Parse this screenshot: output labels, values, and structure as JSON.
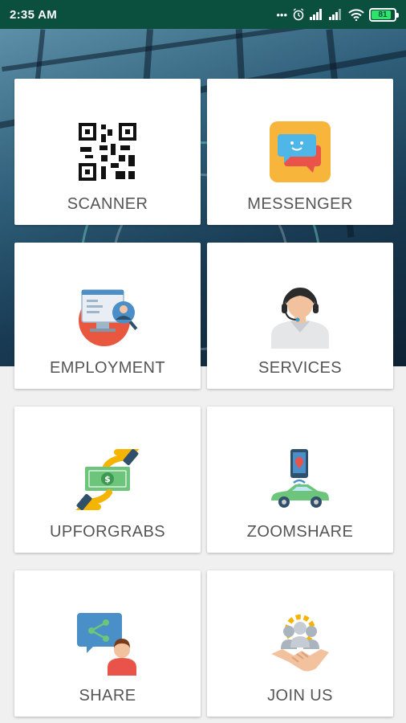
{
  "status_bar": {
    "time": "2:35 AM",
    "dots": "•••",
    "battery_level": "81",
    "icons": [
      "alarm-icon",
      "signal-icon",
      "signal-icon",
      "wifi-icon",
      "battery-icon"
    ]
  },
  "colors": {
    "status_bar": "#0b4f3f",
    "card_label": "#555555",
    "page_background": "#f0f0f0"
  },
  "menu": [
    {
      "label": "SCANNER",
      "icon": "qr-code-icon"
    },
    {
      "label": "MESSENGER",
      "icon": "chat-bubbles-icon"
    },
    {
      "label": "EMPLOYMENT",
      "icon": "job-profile-icon"
    },
    {
      "label": "SERVICES",
      "icon": "customer-support-icon"
    },
    {
      "label": "UPFORGRABS",
      "icon": "money-exchange-icon"
    },
    {
      "label": "ZOOMSHARE",
      "icon": "ride-share-car-icon"
    },
    {
      "label": "SHARE",
      "icon": "share-user-icon"
    },
    {
      "label": "JOIN US",
      "icon": "handshake-team-icon"
    }
  ]
}
